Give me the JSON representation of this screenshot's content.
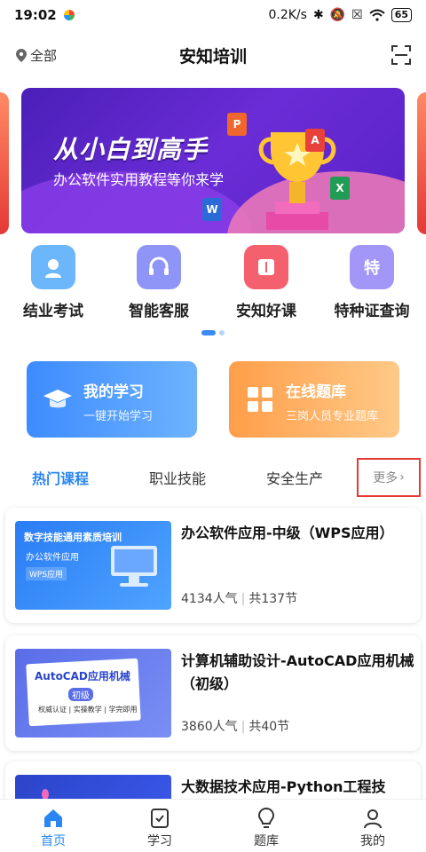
{
  "status_bar": {
    "time": "19:02",
    "net_speed": "0.2K/s",
    "battery": "65"
  },
  "header": {
    "location": "全部",
    "title": "安知培训"
  },
  "banner": {
    "headline": "从小白到高手",
    "subline": "办公软件实用教程等你来学"
  },
  "quick_menu": [
    {
      "label": "结业考试",
      "icon": "graduate-icon",
      "color": "#5aa8f8"
    },
    {
      "label": "智能客服",
      "icon": "headset-icon",
      "color": "#8a8ef5"
    },
    {
      "label": "安知好课",
      "icon": "book-icon",
      "color": "#f55a6a"
    },
    {
      "label": "特种证查询",
      "icon": "certificate-icon",
      "color": "#9a8ef5"
    }
  ],
  "cards": [
    {
      "title": "我的学习",
      "subtitle": "一键开始学习"
    },
    {
      "title": "在线题库",
      "subtitle": "三岗人员专业题库"
    }
  ],
  "tabs": [
    "热门课程",
    "职业技能",
    "安全生产"
  ],
  "more_label": "更多",
  "courses": [
    {
      "title": "办公软件应用-中级（WPS应用）",
      "popularity": "4134人气",
      "lessons": "共137节",
      "thumb_line1": "数字技能通用素质培训",
      "thumb_line2": "办公软件应用",
      "thumb_line3": "WPS应用"
    },
    {
      "title": "计算机辅助设计-AutoCAD应用机械（初级）",
      "popularity": "3860人气",
      "lessons": "共40节",
      "thumb_line1": "AutoCAD应用机械",
      "thumb_line2": "初级",
      "thumb_line3": "权威认证 | 实操教学 | 学完即用"
    },
    {
      "title": "大数据技术应用-Python工程技"
    }
  ],
  "bottom_nav": [
    {
      "label": "首页",
      "icon": "home-icon"
    },
    {
      "label": "学习",
      "icon": "study-icon"
    },
    {
      "label": "题库",
      "icon": "bulb-icon"
    },
    {
      "label": "我的",
      "icon": "profile-icon"
    }
  ],
  "colors": {
    "accent": "#2a86f3",
    "highlight_border": "#e53935"
  }
}
